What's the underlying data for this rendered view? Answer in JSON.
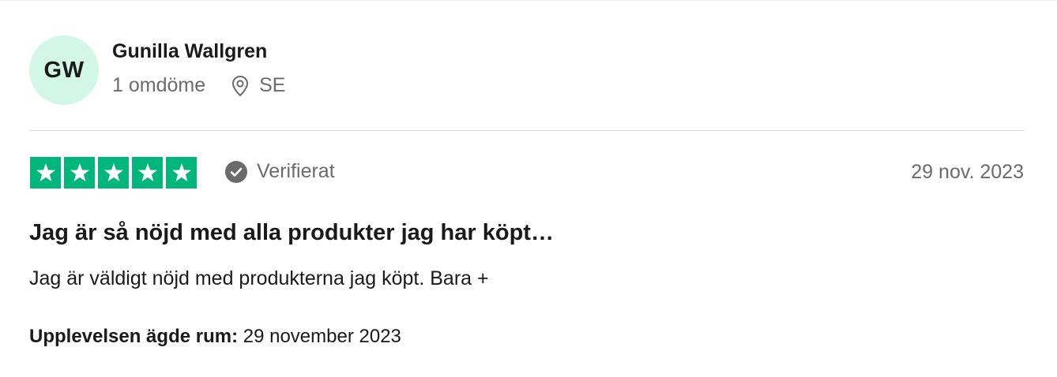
{
  "reviewer": {
    "initials": "GW",
    "name": "Gunilla Wallgren",
    "review_count": "1 omdöme",
    "country": "SE"
  },
  "review": {
    "rating": 5,
    "rating_max": 5,
    "verified_label": "Verifierat",
    "date": "29 nov. 2023",
    "title": "Jag är så nöjd med alla produkter jag har köpt…",
    "body": "Jag är väldigt nöjd med produkterna jag köpt. Bara +",
    "experience_label": "Upplevelsen ägde rum:",
    "experience_date": "29 november 2023"
  },
  "colors": {
    "star_green": "#00b67a",
    "avatar_bg": "#d2f6e7",
    "muted_text": "#6b6b6b"
  },
  "icons": {
    "location": "location-pin-icon",
    "verified": "check-circle-icon",
    "star": "star-icon"
  }
}
